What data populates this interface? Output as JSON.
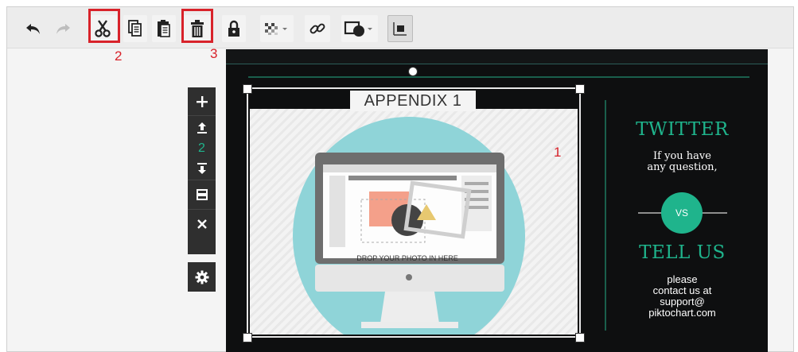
{
  "toolbar": {
    "buttons": [
      {
        "name": "undo-button",
        "icon": "undo-icon"
      },
      {
        "name": "redo-button",
        "icon": "redo-icon"
      },
      {
        "name": "cut-button",
        "icon": "scissors-icon"
      },
      {
        "name": "copy-button",
        "icon": "copy-icon"
      },
      {
        "name": "paste-button",
        "icon": "clipboard-icon"
      },
      {
        "name": "delete-button",
        "icon": "trash-icon"
      },
      {
        "name": "lock-button",
        "icon": "lock-icon"
      },
      {
        "name": "transparency-button",
        "icon": "checker-icon"
      },
      {
        "name": "link-button",
        "icon": "link-icon"
      },
      {
        "name": "shape-button",
        "icon": "shape-icon"
      },
      {
        "name": "arrange-button",
        "icon": "layer-icon"
      }
    ]
  },
  "annotations": {
    "label_1": "1",
    "label_2": "2",
    "label_3": "3"
  },
  "side_panel": {
    "block_number": "2"
  },
  "canvas": {
    "appendix_title": "APPENDIX 1",
    "photo_caption": "DROP YOUR PHOTO IN HERE",
    "twitter_heading": "TWITTER",
    "twitter_text_line1": "If you have",
    "twitter_text_line2": "any question,",
    "vs_label": "VS",
    "tellus_heading": "TELL US",
    "contact_line1": "please",
    "contact_line2": "contact us at",
    "contact_line3": "support@",
    "contact_line4": "piktochart.com"
  },
  "colors": {
    "accent": "#1fb48c",
    "highlight": "#d8222a",
    "canvas_bg": "#0e0f10",
    "panel_bg": "#2f2f2f"
  }
}
